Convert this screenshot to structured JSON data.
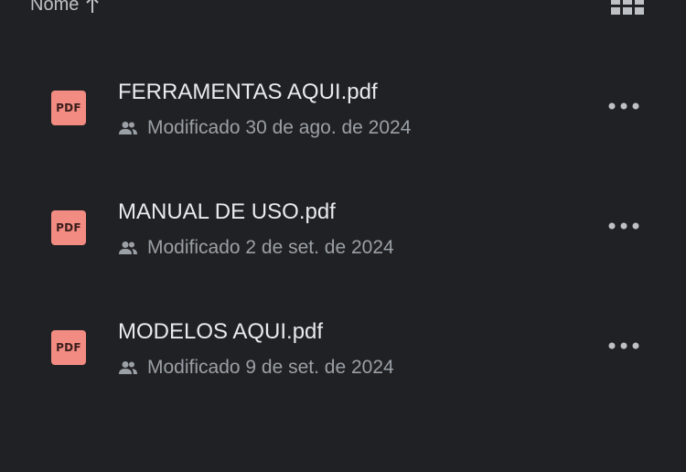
{
  "header": {
    "sort_label": "Nome",
    "sort_icon": "arrow-up-icon",
    "view_icon": "grid-view-icon"
  },
  "files": [
    {
      "icon_label": "PDF",
      "name": "FERRAMENTAS AQUI.pdf",
      "modified": "Modificado 30 de ago. de 2024"
    },
    {
      "icon_label": "PDF",
      "name": "MANUAL DE USO.pdf",
      "modified": "Modificado 2 de set. de 2024"
    },
    {
      "icon_label": "PDF",
      "name": "MODELOS AQUI.pdf",
      "modified": "Modificado 9 de set. de 2024"
    }
  ],
  "colors": {
    "background": "#202124",
    "pdf_icon": "#f28b82",
    "primary_text": "#e8eaed",
    "secondary_text": "#9aa0a6"
  }
}
